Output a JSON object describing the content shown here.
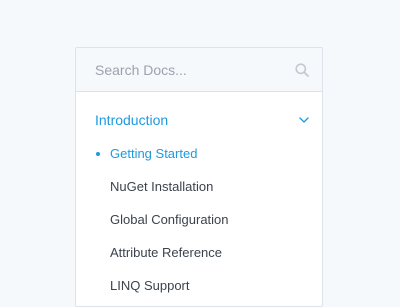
{
  "search": {
    "placeholder": "Search Docs...",
    "icon": "search-icon"
  },
  "section": {
    "title": "Introduction",
    "icon": "chevron-down-icon",
    "expanded": true
  },
  "nav": {
    "items": [
      {
        "label": "Getting Started",
        "active": true
      },
      {
        "label": "NuGet Installation",
        "active": false
      },
      {
        "label": "Global Configuration",
        "active": false
      },
      {
        "label": "Attribute Reference",
        "active": false
      },
      {
        "label": "LINQ Support",
        "active": false
      }
    ]
  },
  "colors": {
    "accent": "#1e9ae0",
    "text": "#3a434d",
    "muted": "#9aa3ad",
    "border": "#dde3ea",
    "background": "#f6f9fc"
  }
}
